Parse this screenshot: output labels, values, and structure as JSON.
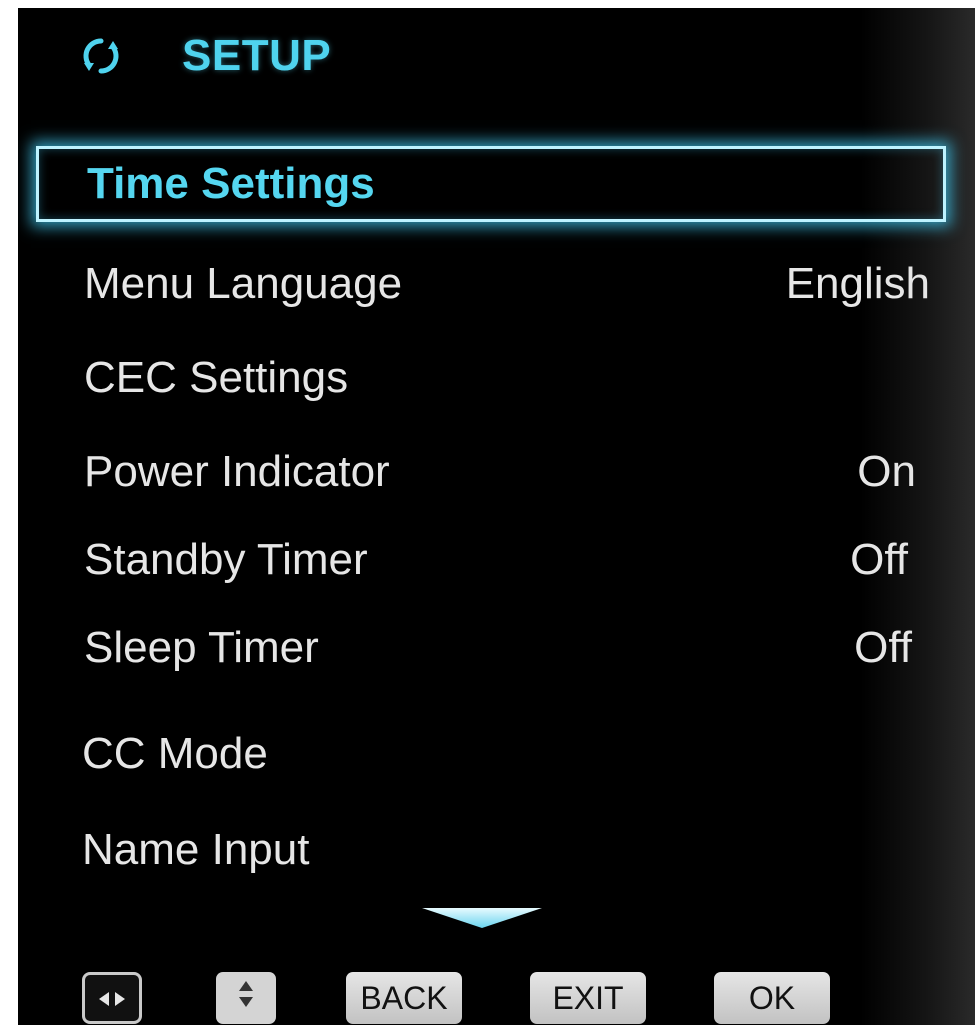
{
  "header": {
    "title": "SETUP",
    "icon": "refresh-icon"
  },
  "menu": {
    "items": [
      {
        "label": "Time Settings",
        "value": "",
        "selected": true
      },
      {
        "label": "Menu Language",
        "value": "English",
        "selected": false
      },
      {
        "label": "CEC Settings",
        "value": "",
        "selected": false
      },
      {
        "label": "Power Indicator",
        "value": "On",
        "selected": false
      },
      {
        "label": "Standby Timer",
        "value": "Off",
        "selected": false
      },
      {
        "label": "Sleep Timer",
        "value": "Off",
        "selected": false
      },
      {
        "label": "CC Mode",
        "value": "",
        "selected": false
      },
      {
        "label": "Name Input",
        "value": "",
        "selected": false
      }
    ]
  },
  "footer": {
    "left_right_icon": "left-right-arrows-icon",
    "up_down_icon": "up-down-arrows-icon",
    "back_label": "BACK",
    "exit_label": "EXIT",
    "ok_label": "OK"
  },
  "colors": {
    "accent": "#4fd3ee",
    "background": "#000000",
    "text": "#e6e6e6",
    "button": "#d4d4d4"
  }
}
